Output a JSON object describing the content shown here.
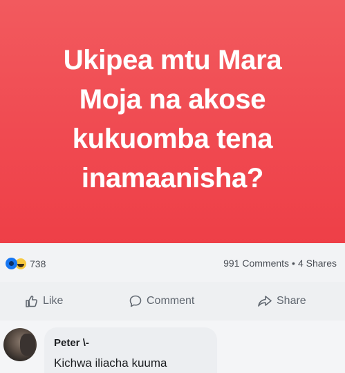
{
  "post": {
    "banner_lines": [
      "Ukipea mtu Mara",
      "Moja na akose",
      "kukuomba tena",
      "inamaanisha?"
    ],
    "banner_color": "#f04a51",
    "reactions": {
      "icons": [
        "like-reaction-icon",
        "haha-reaction-icon"
      ],
      "count": "738"
    },
    "comments_count": "991 Comments",
    "separator": "•",
    "shares_count": "4 Shares"
  },
  "actions": {
    "like_label": "Like",
    "comment_label": "Comment",
    "share_label": "Share"
  },
  "comment": {
    "author": "Peter \\-",
    "text": "Kichwa iliacha kuuma"
  }
}
